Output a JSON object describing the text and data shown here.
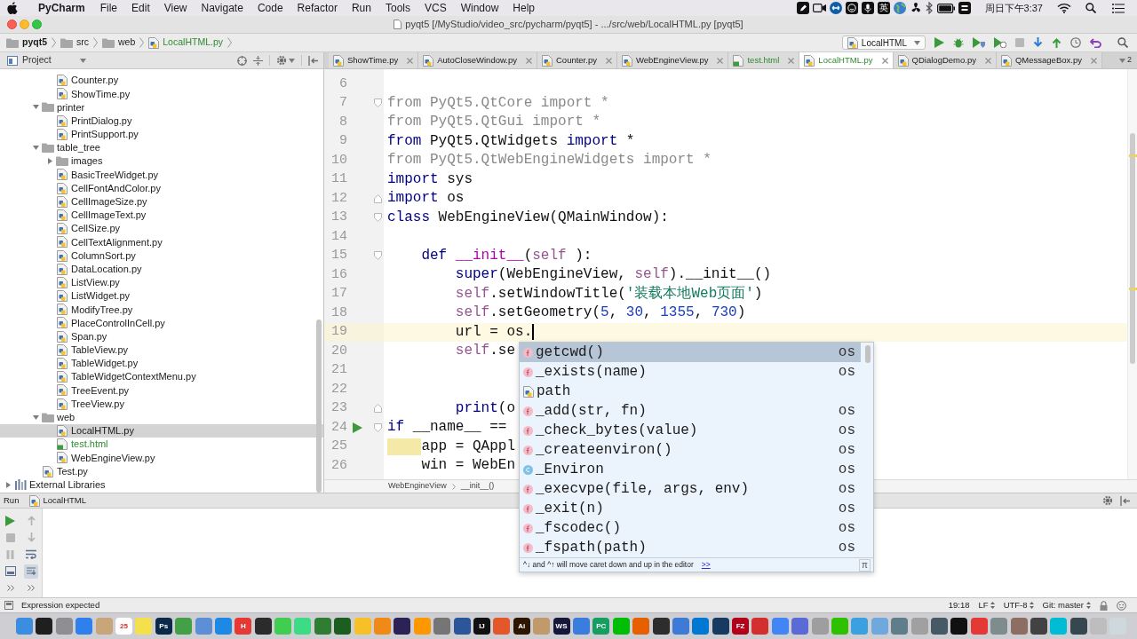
{
  "menu_bar": {
    "app": "PyCharm",
    "menus": [
      "File",
      "Edit",
      "View",
      "Navigate",
      "Code",
      "Refactor",
      "Run",
      "Tools",
      "VCS",
      "Window",
      "Help"
    ],
    "input_method": "英",
    "clock": "周日下午3:37"
  },
  "window": {
    "title": "pyqt5 [/MyStudio/video_src/pycharm/pyqt5] - .../src/web/LocalHTML.py [pyqt5]"
  },
  "navigation": {
    "breadcrumbs": [
      {
        "label": "pyqt5",
        "kind": "root",
        "added": false
      },
      {
        "label": "src",
        "kind": "folder",
        "added": false
      },
      {
        "label": "web",
        "kind": "folder",
        "added": false
      },
      {
        "label": "LocalHTML.py",
        "kind": "python",
        "added": true
      }
    ],
    "run_config": "LocalHTML"
  },
  "project_panel": {
    "title": "Project",
    "tree": [
      {
        "children": [
          {
            "children": [
              {
                "label": "Counter.py",
                "kind": "python",
                "added": false,
                "selected": false
              },
              {
                "label": "ShowTime.py",
                "kind": "python",
                "added": false,
                "selected": false
              }
            ]
          },
          {
            "label": "printer",
            "kind": "folder",
            "expanded": true,
            "selected": false,
            "children": [
              {
                "label": "PrintDialog.py",
                "kind": "python",
                "added": false,
                "selected": false
              },
              {
                "label": "PrintSupport.py",
                "kind": "python",
                "added": false,
                "selected": false
              }
            ]
          },
          {
            "label": "table_tree",
            "kind": "folder",
            "expanded": true,
            "selected": false,
            "children": [
              {
                "label": "images",
                "kind": "folder",
                "expanded": false,
                "selected": false
              },
              {
                "label": "BasicTreeWidget.py",
                "kind": "python",
                "added": false,
                "selected": false
              },
              {
                "label": "CellFontAndColor.py",
                "kind": "python",
                "added": false,
                "selected": false
              },
              {
                "label": "CellImageSize.py",
                "kind": "python",
                "added": false,
                "selected": false
              },
              {
                "label": "CellImageText.py",
                "kind": "python",
                "added": false,
                "selected": false
              },
              {
                "label": "CellSize.py",
                "kind": "python",
                "added": false,
                "selected": false
              },
              {
                "label": "CellTextAlignment.py",
                "kind": "python",
                "added": false,
                "selected": false
              },
              {
                "label": "ColumnSort.py",
                "kind": "python",
                "added": false,
                "selected": false
              },
              {
                "label": "DataLocation.py",
                "kind": "python",
                "added": false,
                "selected": false
              },
              {
                "label": "ListView.py",
                "kind": "python",
                "added": false,
                "selected": false
              },
              {
                "label": "ListWidget.py",
                "kind": "python",
                "added": false,
                "selected": false
              },
              {
                "label": "ModifyTree.py",
                "kind": "python",
                "added": false,
                "selected": false
              },
              {
                "label": "PlaceControlInCell.py",
                "kind": "python",
                "added": false,
                "selected": false
              },
              {
                "label": "Span.py",
                "kind": "python",
                "added": false,
                "selected": false
              },
              {
                "label": "TableView.py",
                "kind": "python",
                "added": false,
                "selected": false
              },
              {
                "label": "TableWidget.py",
                "kind": "python",
                "added": false,
                "selected": false
              },
              {
                "label": "TableWidgetContextMenu.py",
                "kind": "python",
                "added": false,
                "selected": false
              },
              {
                "label": "TreeEvent.py",
                "kind": "python",
                "added": false,
                "selected": false
              },
              {
                "label": "TreeView.py",
                "kind": "python",
                "added": false,
                "selected": false
              }
            ]
          },
          {
            "label": "web",
            "kind": "folder",
            "expanded": true,
            "selected": false,
            "children": [
              {
                "label": "LocalHTML.py",
                "kind": "python",
                "added": false,
                "selected": true
              },
              {
                "label": "test.html",
                "kind": "html",
                "added": true,
                "selected": false
              },
              {
                "label": "WebEngineView.py",
                "kind": "python",
                "added": false,
                "selected": false
              }
            ]
          },
          {
            "label": "Test.py",
            "kind": "python",
            "added": false,
            "selected": false
          }
        ]
      },
      {
        "label": "External Libraries",
        "kind": "libraries",
        "expanded": false,
        "selected": false
      }
    ]
  },
  "editor": {
    "tabs": [
      {
        "label": "ShowTime.py",
        "kind": "python",
        "added": false,
        "selected": false
      },
      {
        "label": "AutoCloseWindow.py",
        "kind": "python",
        "added": false,
        "selected": false
      },
      {
        "label": "Counter.py",
        "kind": "python",
        "added": false,
        "selected": false
      },
      {
        "label": "WebEngineView.py",
        "kind": "python",
        "added": false,
        "selected": false
      },
      {
        "label": "test.html",
        "kind": "html",
        "added": true,
        "selected": false
      },
      {
        "label": "LocalHTML.py",
        "kind": "python",
        "added": true,
        "selected": true
      },
      {
        "label": "QDialogDemo.py",
        "kind": "python",
        "added": false,
        "selected": false
      },
      {
        "label": "QMessageBox.py",
        "kind": "python",
        "added": false,
        "selected": false
      }
    ],
    "tab_overflow": "2",
    "lines": [
      {
        "number": "6",
        "fold_start": false,
        "fold_end": false,
        "current": false,
        "run_marker": false,
        "indent_warning": false
      },
      {
        "number": "7",
        "fold_start": true,
        "fold_end": false,
        "current": false,
        "run_marker": false,
        "indent_warning": false,
        "tokens": [
          {
            "kind": "unused",
            "text": "from PyQt5.QtCore import *"
          }
        ]
      },
      {
        "number": "8",
        "fold_start": false,
        "fold_end": false,
        "current": false,
        "run_marker": false,
        "indent_warning": false,
        "tokens": [
          {
            "kind": "unused",
            "text": "from PyQt5.QtGui import *"
          }
        ]
      },
      {
        "number": "9",
        "fold_start": false,
        "fold_end": false,
        "current": false,
        "run_marker": false,
        "indent_warning": false,
        "tokens": [
          {
            "kind": "keyword",
            "text": "from"
          },
          {
            "kind": "plain",
            "text": " PyQt5.QtWidgets "
          },
          {
            "kind": "keyword",
            "text": "import"
          },
          {
            "kind": "plain",
            "text": " *"
          }
        ]
      },
      {
        "number": "10",
        "fold_start": false,
        "fold_end": false,
        "current": false,
        "run_marker": false,
        "indent_warning": false,
        "tokens": [
          {
            "kind": "unused",
            "text": "from PyQt5.QtWebEngineWidgets import *"
          }
        ]
      },
      {
        "number": "11",
        "fold_start": false,
        "fold_end": false,
        "current": false,
        "run_marker": false,
        "indent_warning": false,
        "tokens": [
          {
            "kind": "keyword",
            "text": "import"
          },
          {
            "kind": "plain",
            "text": " sys"
          }
        ]
      },
      {
        "number": "12",
        "fold_start": false,
        "fold_end": true,
        "current": false,
        "run_marker": false,
        "indent_warning": false,
        "tokens": [
          {
            "kind": "keyword",
            "text": "import"
          },
          {
            "kind": "plain",
            "text": " os"
          }
        ]
      },
      {
        "number": "13",
        "fold_start": true,
        "fold_end": false,
        "current": false,
        "run_marker": false,
        "indent_warning": false,
        "tokens": [
          {
            "kind": "keyword",
            "text": "class"
          },
          {
            "kind": "plain",
            "text": " WebEngineView(QMainWindow):"
          }
        ]
      },
      {
        "number": "14",
        "fold_start": false,
        "fold_end": false,
        "current": false,
        "run_marker": false,
        "indent_warning": false
      },
      {
        "number": "15",
        "fold_start": true,
        "fold_end": false,
        "current": false,
        "run_marker": false,
        "indent_warning": false,
        "tokens": [
          {
            "kind": "keyword",
            "text": "    def "
          },
          {
            "kind": "magic",
            "text": "__init__"
          },
          {
            "kind": "plain",
            "text": "("
          },
          {
            "kind": "self",
            "text": "self"
          },
          {
            "kind": "plain",
            "text": " ):"
          }
        ]
      },
      {
        "number": "16",
        "fold_start": false,
        "fold_end": false,
        "current": false,
        "run_marker": false,
        "indent_warning": false,
        "tokens": [
          {
            "kind": "keyword",
            "text": "        super"
          },
          {
            "kind": "plain",
            "text": "(WebEngineView, "
          },
          {
            "kind": "self",
            "text": "self"
          },
          {
            "kind": "plain",
            "text": ").__init__()"
          }
        ]
      },
      {
        "number": "17",
        "fold_start": false,
        "fold_end": false,
        "current": false,
        "run_marker": false,
        "indent_warning": false,
        "tokens": [
          {
            "kind": "self",
            "text": "        self"
          },
          {
            "kind": "plain",
            "text": ".setWindowTitle("
          },
          {
            "kind": "string",
            "text": "'装载本地Web页面'"
          },
          {
            "kind": "plain",
            "text": ")"
          }
        ]
      },
      {
        "number": "18",
        "fold_start": false,
        "fold_end": false,
        "current": false,
        "run_marker": false,
        "indent_warning": false,
        "tokens": [
          {
            "kind": "self",
            "text": "        self"
          },
          {
            "kind": "plain",
            "text": ".setGeometry("
          },
          {
            "kind": "number",
            "text": "5"
          },
          {
            "kind": "plain",
            "text": ", "
          },
          {
            "kind": "number",
            "text": "30"
          },
          {
            "kind": "plain",
            "text": ", "
          },
          {
            "kind": "number",
            "text": "1355"
          },
          {
            "kind": "plain",
            "text": ", "
          },
          {
            "kind": "number",
            "text": "730"
          },
          {
            "kind": "plain",
            "text": ")"
          }
        ]
      },
      {
        "number": "19",
        "fold_start": false,
        "fold_end": false,
        "current": true,
        "run_marker": false,
        "indent_warning": false,
        "tokens": [
          {
            "kind": "plain",
            "text": "        url = os."
          }
        ]
      },
      {
        "number": "20",
        "fold_start": false,
        "fold_end": false,
        "current": false,
        "run_marker": false,
        "indent_warning": false,
        "tokens": [
          {
            "kind": "self",
            "text": "        self"
          },
          {
            "kind": "plain",
            "text": ".se"
          }
        ]
      },
      {
        "number": "21",
        "fold_start": false,
        "fold_end": false,
        "current": false,
        "run_marker": false,
        "indent_warning": false
      },
      {
        "number": "22",
        "fold_start": false,
        "fold_end": false,
        "current": false,
        "run_marker": false,
        "indent_warning": false
      },
      {
        "number": "23",
        "fold_start": false,
        "fold_end": true,
        "current": false,
        "run_marker": false,
        "indent_warning": false,
        "tokens": [
          {
            "kind": "keyword",
            "text": "        print"
          },
          {
            "kind": "plain",
            "text": "(o"
          }
        ]
      },
      {
        "number": "24",
        "fold_start": true,
        "fold_end": false,
        "current": false,
        "run_marker": true,
        "indent_warning": false,
        "tokens": [
          {
            "kind": "keyword",
            "text": "if"
          },
          {
            "kind": "plain",
            "text": " __name__ =="
          }
        ]
      },
      {
        "number": "25",
        "fold_start": false,
        "fold_end": false,
        "current": false,
        "run_marker": false,
        "indent_warning": true,
        "tokens": [
          {
            "kind": "plain",
            "text": "    app = QAppl"
          }
        ]
      },
      {
        "number": "26",
        "fold_start": false,
        "fold_end": false,
        "current": false,
        "run_marker": false,
        "indent_warning": false,
        "tokens": [
          {
            "kind": "plain",
            "text": "    win = WebEn"
          }
        ]
      }
    ],
    "breadcrumbs": [
      "WebEngineView",
      "__init__()"
    ]
  },
  "completion": {
    "items": [
      {
        "name": "getcwd()",
        "kind": "function",
        "source": "os",
        "selected": true
      },
      {
        "name": "_exists(name)",
        "kind": "function",
        "source": "os",
        "selected": false
      },
      {
        "name": "path",
        "kind": "module",
        "selected": false
      },
      {
        "name": "_add(str, fn)",
        "kind": "function",
        "source": "os",
        "selected": false
      },
      {
        "name": "_check_bytes(value)",
        "kind": "function",
        "source": "os",
        "selected": false
      },
      {
        "name": "_createenviron()",
        "kind": "function",
        "source": "os",
        "selected": false
      },
      {
        "name": "_Environ",
        "kind": "class",
        "source": "os",
        "selected": false
      },
      {
        "name": "_execvpe(file, args, env)",
        "kind": "function",
        "source": "os",
        "selected": false
      },
      {
        "name": "_exit(n)",
        "kind": "function",
        "source": "os",
        "selected": false
      },
      {
        "name": "_fscodec()",
        "kind": "function",
        "source": "os",
        "selected": false
      },
      {
        "name": "_fspath(path)",
        "kind": "function",
        "source": "os",
        "selected": false
      }
    ],
    "hint": "^↓ and ^↑ will move caret down and up in the editor",
    "more_link": ">>",
    "corner_glyph": "π"
  },
  "run_panel": {
    "title": "Run",
    "tab": "LocalHTML"
  },
  "status_bar": {
    "message": "Expression expected",
    "position": "19:18",
    "line_separator": "LF",
    "encoding": "UTF-8",
    "vcs": "Git: master"
  },
  "dock": [
    {
      "color": "#3b8de0"
    },
    {
      "color": "#1f1f1f"
    },
    {
      "color": "#8e8e93"
    },
    {
      "color": "#2f80ed"
    },
    {
      "color": "#c9a57a"
    },
    {
      "color": "#ffffff",
      "label": "25"
    },
    {
      "color": "#f4e04d"
    },
    {
      "color": "#0b2a4a",
      "label": "Ps"
    },
    {
      "color": "#43a047"
    },
    {
      "color": "#5c8fd6"
    },
    {
      "color": "#1e88e5"
    },
    {
      "color": "#e53935",
      "label": "H"
    },
    {
      "color": "#2b2b2b"
    },
    {
      "color": "#41cd52"
    },
    {
      "color": "#3ddc84"
    },
    {
      "color": "#2e7d32"
    },
    {
      "color": "#1b5e20"
    },
    {
      "color": "#f6c026"
    },
    {
      "color": "#ef8a17"
    },
    {
      "color": "#2c2255"
    },
    {
      "color": "#ff9800"
    },
    {
      "color": "#757575"
    },
    {
      "color": "#2b579a"
    },
    {
      "color": "#111111",
      "label": "IJ"
    },
    {
      "color": "#e3572b"
    },
    {
      "color": "#2d1600",
      "label": "Ai"
    },
    {
      "color": "#c19a6b"
    },
    {
      "color": "#16163a",
      "label": "WS"
    },
    {
      "color": "#3b7ddd"
    },
    {
      "color": "#159e5f",
      "label": "PC"
    },
    {
      "color": "#00be06"
    },
    {
      "color": "#e66000"
    },
    {
      "color": "#2d2d2d"
    },
    {
      "color": "#3d7bd6"
    },
    {
      "color": "#0078d4"
    },
    {
      "color": "#183a61"
    },
    {
      "color": "#b3001b",
      "label": "FZ"
    },
    {
      "color": "#d32f2f"
    },
    {
      "color": "#4285f4"
    },
    {
      "color": "#5b6bd5"
    },
    {
      "color": "#9e9e9e"
    },
    {
      "color": "#2dc100"
    },
    {
      "color": "#3aa0e0"
    },
    {
      "color": "#6fa8dc"
    },
    {
      "color": "#607d8b"
    },
    {
      "color": "#a0a0a0"
    },
    {
      "color": "#455a64"
    },
    {
      "color": "#111111"
    },
    {
      "color": "#e53935"
    },
    {
      "color": "#7f8c8d"
    },
    {
      "color": "#8d6e63"
    },
    {
      "color": "#424242"
    },
    {
      "color": "#00bcd4"
    },
    {
      "color": "#37474f"
    },
    {
      "color": "#bdbdbd"
    },
    {
      "color": "#cfd8dc"
    }
  ]
}
